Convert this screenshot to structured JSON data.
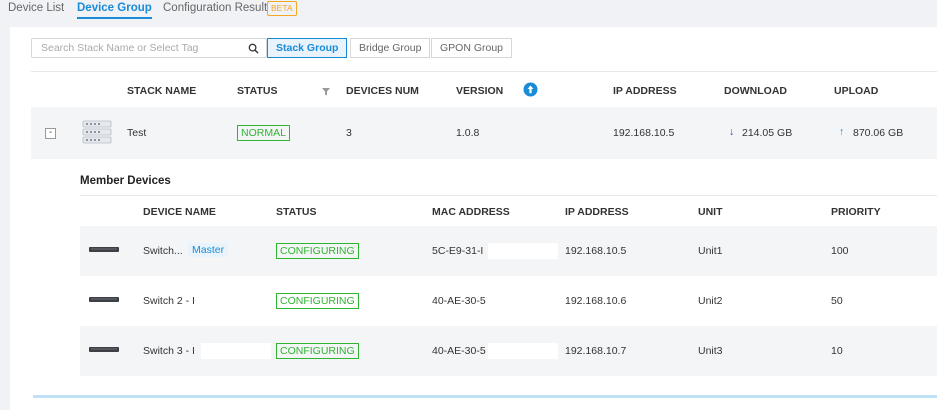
{
  "top_tabs": [
    {
      "label": "Device List",
      "active": false
    },
    {
      "label": "Device Group",
      "active": true
    },
    {
      "label": "Configuration Result",
      "active": false
    }
  ],
  "beta_badge": "BETA",
  "search": {
    "placeholder": "Search Stack Name or Select Tag",
    "value": "",
    "icon": "search-icon"
  },
  "group_tabs": [
    {
      "label": "Stack Group",
      "active": true
    },
    {
      "label": "Bridge Group",
      "active": false
    },
    {
      "label": "GPON Group",
      "active": false
    }
  ],
  "table": {
    "columns": [
      "STACK NAME",
      "STATUS",
      "DEVICES NUM",
      "VERSION",
      "IP ADDRESS",
      "DOWNLOAD",
      "UPLOAD"
    ],
    "rows": [
      {
        "expand_symbol": "-",
        "name": "Test",
        "status": "NORMAL",
        "devices_num": "3",
        "version": "1.0.8",
        "ip": "192.168.10.5",
        "download_arrow": "↓",
        "download": "214.05 GB",
        "upload_arrow": "↑",
        "upload": "870.06 GB"
      }
    ]
  },
  "member_devices": {
    "title": "Member Devices",
    "columns": [
      "DEVICE NAME",
      "STATUS",
      "MAC ADDRESS",
      "IP ADDRESS",
      "UNIT",
      "PRIORITY"
    ],
    "rows": [
      {
        "name": "Switch...",
        "tag": "Master",
        "status": "CONFIGURING",
        "mac": "5C-E9-31-I",
        "ip": "192.168.10.5",
        "unit": "Unit1",
        "priority": "100"
      },
      {
        "name": "Switch 2 - I",
        "status": "CONFIGURING",
        "mac": "40-AE-30-5",
        "ip": "192.168.10.6",
        "unit": "Unit2",
        "priority": "50"
      },
      {
        "name": "Switch 3 - I",
        "status": "CONFIGURING",
        "mac": "40-AE-30-5",
        "ip": "192.168.10.7",
        "unit": "Unit3",
        "priority": "10"
      }
    ]
  },
  "colors": {
    "accent": "#1a8bd8",
    "status_green": "#2fb52f",
    "beta_orange": "#f5a623",
    "download_arrow": "#2a3fb5"
  }
}
